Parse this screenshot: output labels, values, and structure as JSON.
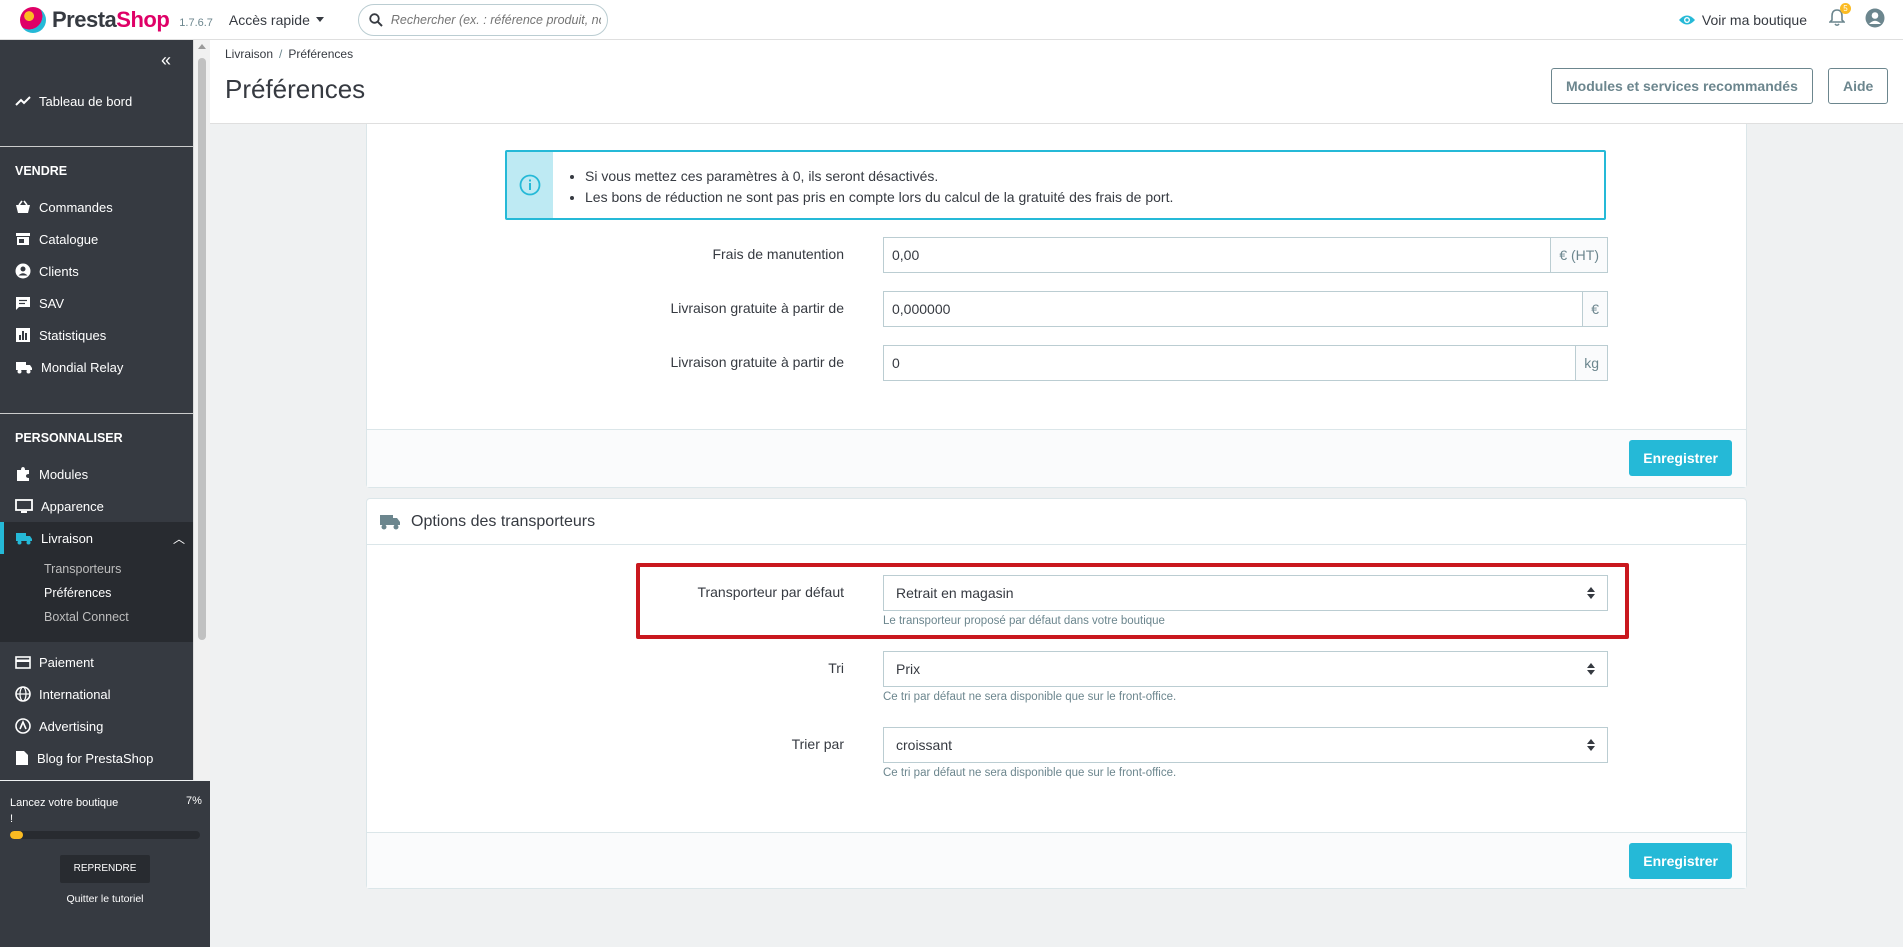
{
  "header": {
    "logo_prefix": "Presta",
    "logo_suffix": "Shop",
    "version": "1.7.6.7",
    "quick_access": "Accès rapide",
    "search_placeholder": "Rechercher (ex. : référence produit, nom",
    "view_shop": "Voir ma boutique",
    "notifications_count": "5"
  },
  "sidebar": {
    "dashboard": "Tableau de bord",
    "section_sell": "VENDRE",
    "orders": "Commandes",
    "catalog": "Catalogue",
    "customers": "Clients",
    "sav": "SAV",
    "stats": "Statistiques",
    "mondial_relay": "Mondial Relay",
    "section_customize": "PERSONNALISER",
    "modules": "Modules",
    "appearance": "Apparence",
    "shipping": "Livraison",
    "sub_carriers": "Transporteurs",
    "sub_preferences": "Préférences",
    "sub_boxtal": "Boxtal Connect",
    "payment": "Paiement",
    "international": "International",
    "advertising": "Advertising",
    "blog": "Blog for PrestaShop"
  },
  "onboarding": {
    "text": "Lancez votre boutique !",
    "percent_label": "7%",
    "progress": 0.07,
    "resume": "REPRENDRE",
    "quit": "Quitter le tutoriel"
  },
  "page": {
    "breadcrumb_parent": "Livraison",
    "breadcrumb_current": "Préférences",
    "title": "Préférences",
    "btn_modules": "Modules et services recommandés",
    "btn_help": "Aide"
  },
  "handling": {
    "info_1": "Si vous mettez ces paramètres à 0, ils seront désactivés.",
    "info_2": "Les bons de réduction ne sont pas pris en compte lors du calcul de la gratuité des frais de port.",
    "handling_label": "Frais de manutention",
    "handling_value": "0,00",
    "handling_unit": "€ (HT)",
    "free_price_label": "Livraison gratuite à partir de",
    "free_price_value": "0,000000",
    "free_price_unit": "€",
    "free_weight_label": "Livraison gratuite à partir de",
    "free_weight_value": "0",
    "free_weight_unit": "kg",
    "save": "Enregistrer"
  },
  "carriers": {
    "heading": "Options des transporteurs",
    "default_label": "Transporteur par défaut",
    "default_value": "Retrait en magasin",
    "default_help": "Le transporteur proposé par défaut dans votre boutique",
    "sort_label": "Tri",
    "sort_value": "Prix",
    "sort_help": "Ce tri par défaut ne sera disponible que sur le front-office.",
    "order_label": "Trier par",
    "order_value": "croissant",
    "order_help": "Ce tri par défaut ne sera disponible que sur le front-office.",
    "save": "Enregistrer"
  },
  "colors": {
    "accent": "#25b9d7",
    "sidebar": "#363a41",
    "highlight": "#c9181e",
    "brand_pink": "#df0067"
  }
}
